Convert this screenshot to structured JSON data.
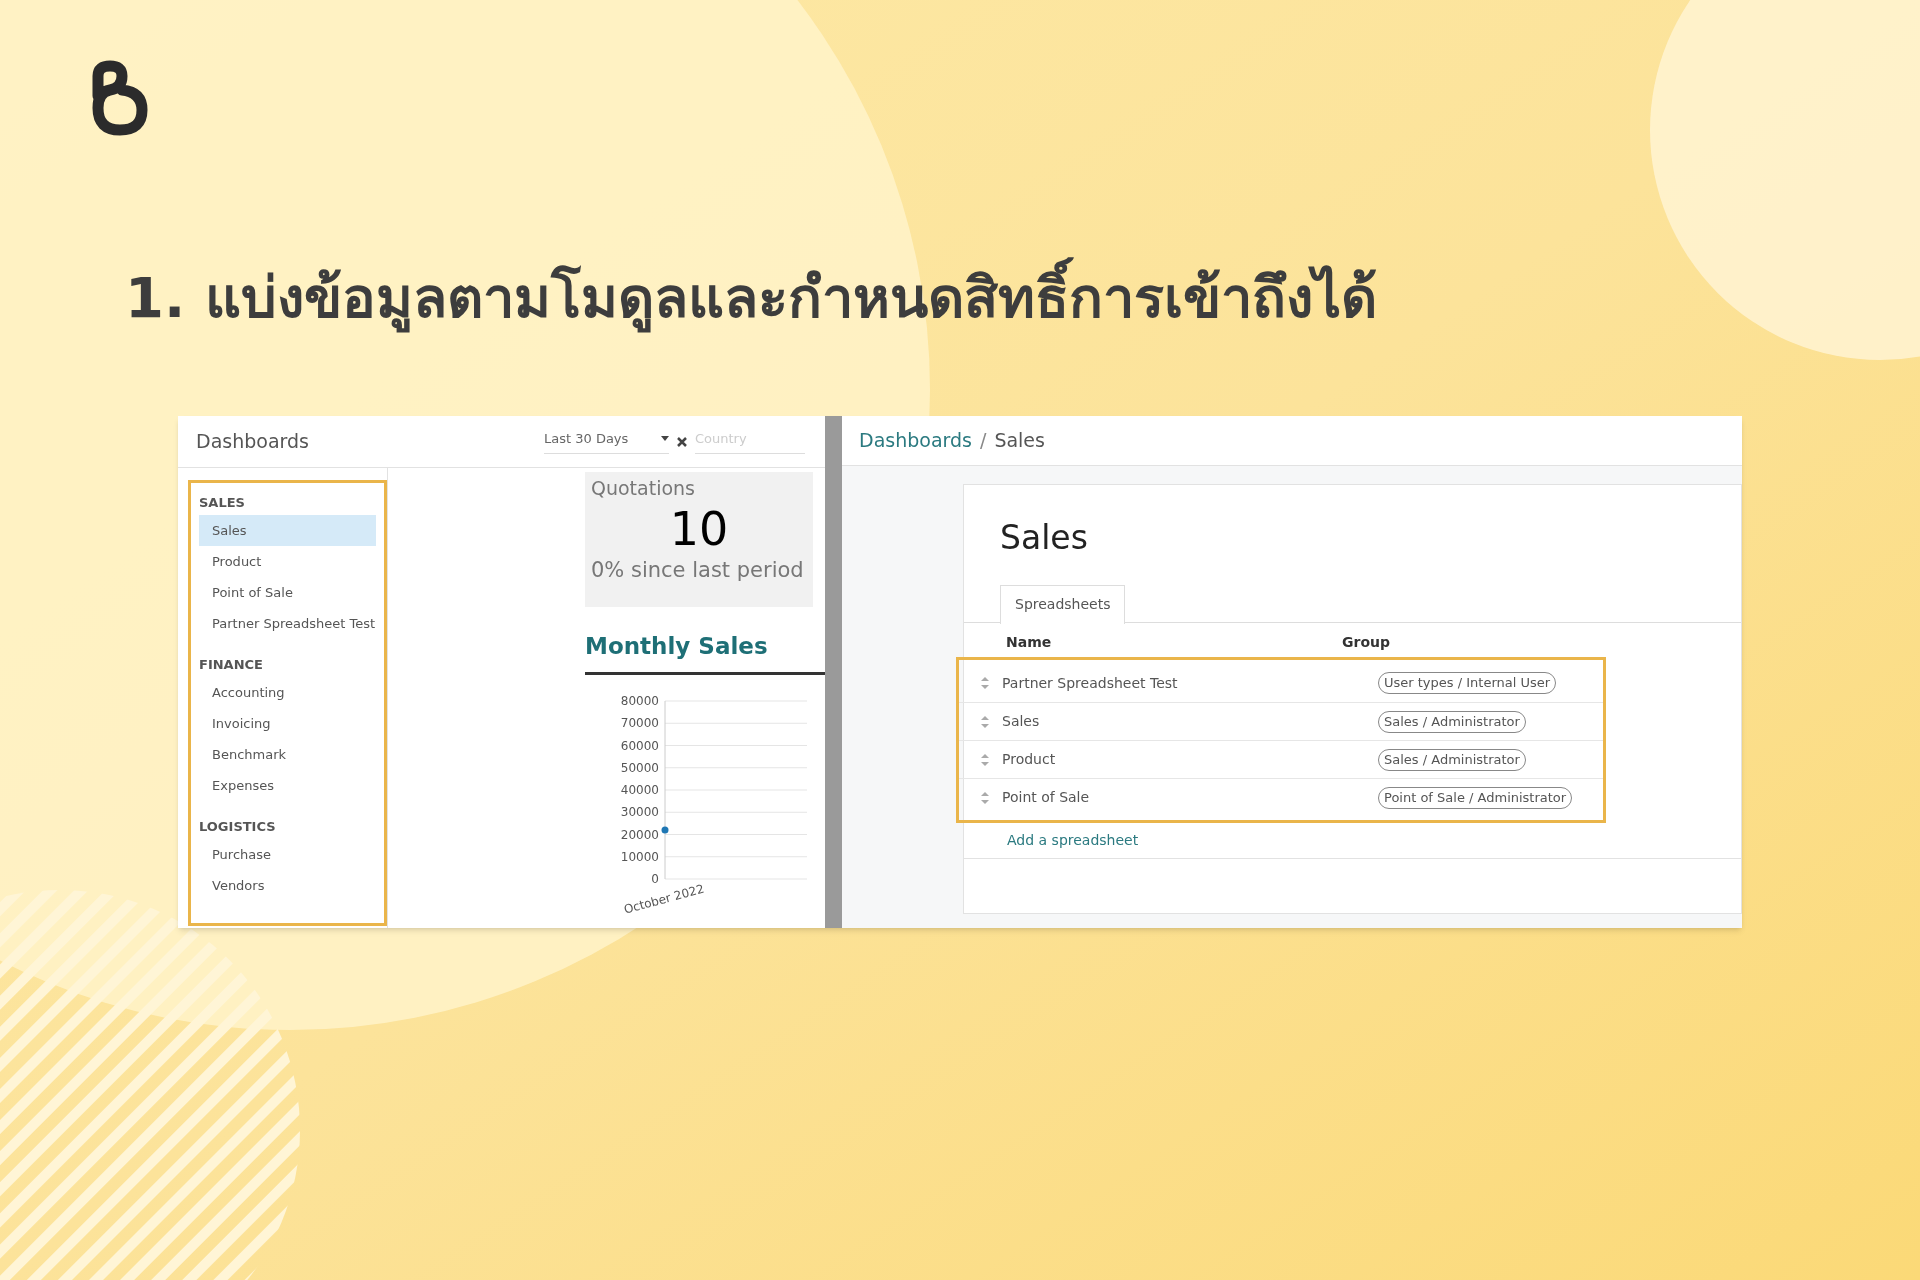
{
  "title": "1. แบ่งข้อมูลตามโมดูลและกำหนดสิทธิ์การเข้าถึงได้",
  "left_panel": {
    "header": {
      "title": "Dashboards",
      "date_filter": "Last 30 Days",
      "country_placeholder": "Country"
    },
    "sidebar": [
      {
        "heading": "SALES",
        "items": [
          {
            "label": "Sales",
            "selected": true
          },
          {
            "label": "Product",
            "selected": false
          },
          {
            "label": "Point of Sale",
            "selected": false
          },
          {
            "label": "Partner Spreadsheet Test",
            "selected": false
          }
        ]
      },
      {
        "heading": "FINANCE",
        "items": [
          {
            "label": "Accounting",
            "selected": false
          },
          {
            "label": "Invoicing",
            "selected": false
          },
          {
            "label": "Benchmark",
            "selected": false
          },
          {
            "label": "Expenses",
            "selected": false
          }
        ]
      },
      {
        "heading": "LOGISTICS",
        "items": [
          {
            "label": "Purchase",
            "selected": false
          },
          {
            "label": "Vendors",
            "selected": false
          }
        ]
      }
    ],
    "quotations": {
      "label": "Quotations",
      "value": "10",
      "change": "0% since last period"
    },
    "monthly_sales": {
      "title": "Monthly Sales",
      "chart_data": {
        "type": "line",
        "categories": [
          "October 2022"
        ],
        "grid": true,
        "series": [
          {
            "color": "#1f77b4",
            "marker": "circle",
            "values": [
              22000
            ]
          }
        ],
        "ylim": [
          0,
          80000
        ],
        "yticks": [
          0,
          10000,
          20000,
          30000,
          40000,
          50000,
          60000,
          70000,
          80000
        ]
      }
    }
  },
  "right_panel": {
    "breadcrumb": [
      {
        "label": "Dashboards",
        "kind": "link"
      },
      {
        "label": "Sales",
        "kind": "current"
      }
    ],
    "breadcrumb_separator": "/",
    "record_title": "Sales",
    "tabs": [
      {
        "label": "Spreadsheets",
        "selected": true
      }
    ],
    "table": {
      "columns": [
        "Name",
        "Group"
      ],
      "rows": [
        {
          "name": "Partner Spreadsheet Test",
          "group": "User types / Internal User"
        },
        {
          "name": "Sales",
          "group": "Sales / Administrator"
        },
        {
          "name": "Product",
          "group": "Sales / Administrator"
        },
        {
          "name": "Point of Sale",
          "group": "Point of Sale / Administrator"
        }
      ]
    },
    "add_link": "Add a spreadsheet"
  }
}
